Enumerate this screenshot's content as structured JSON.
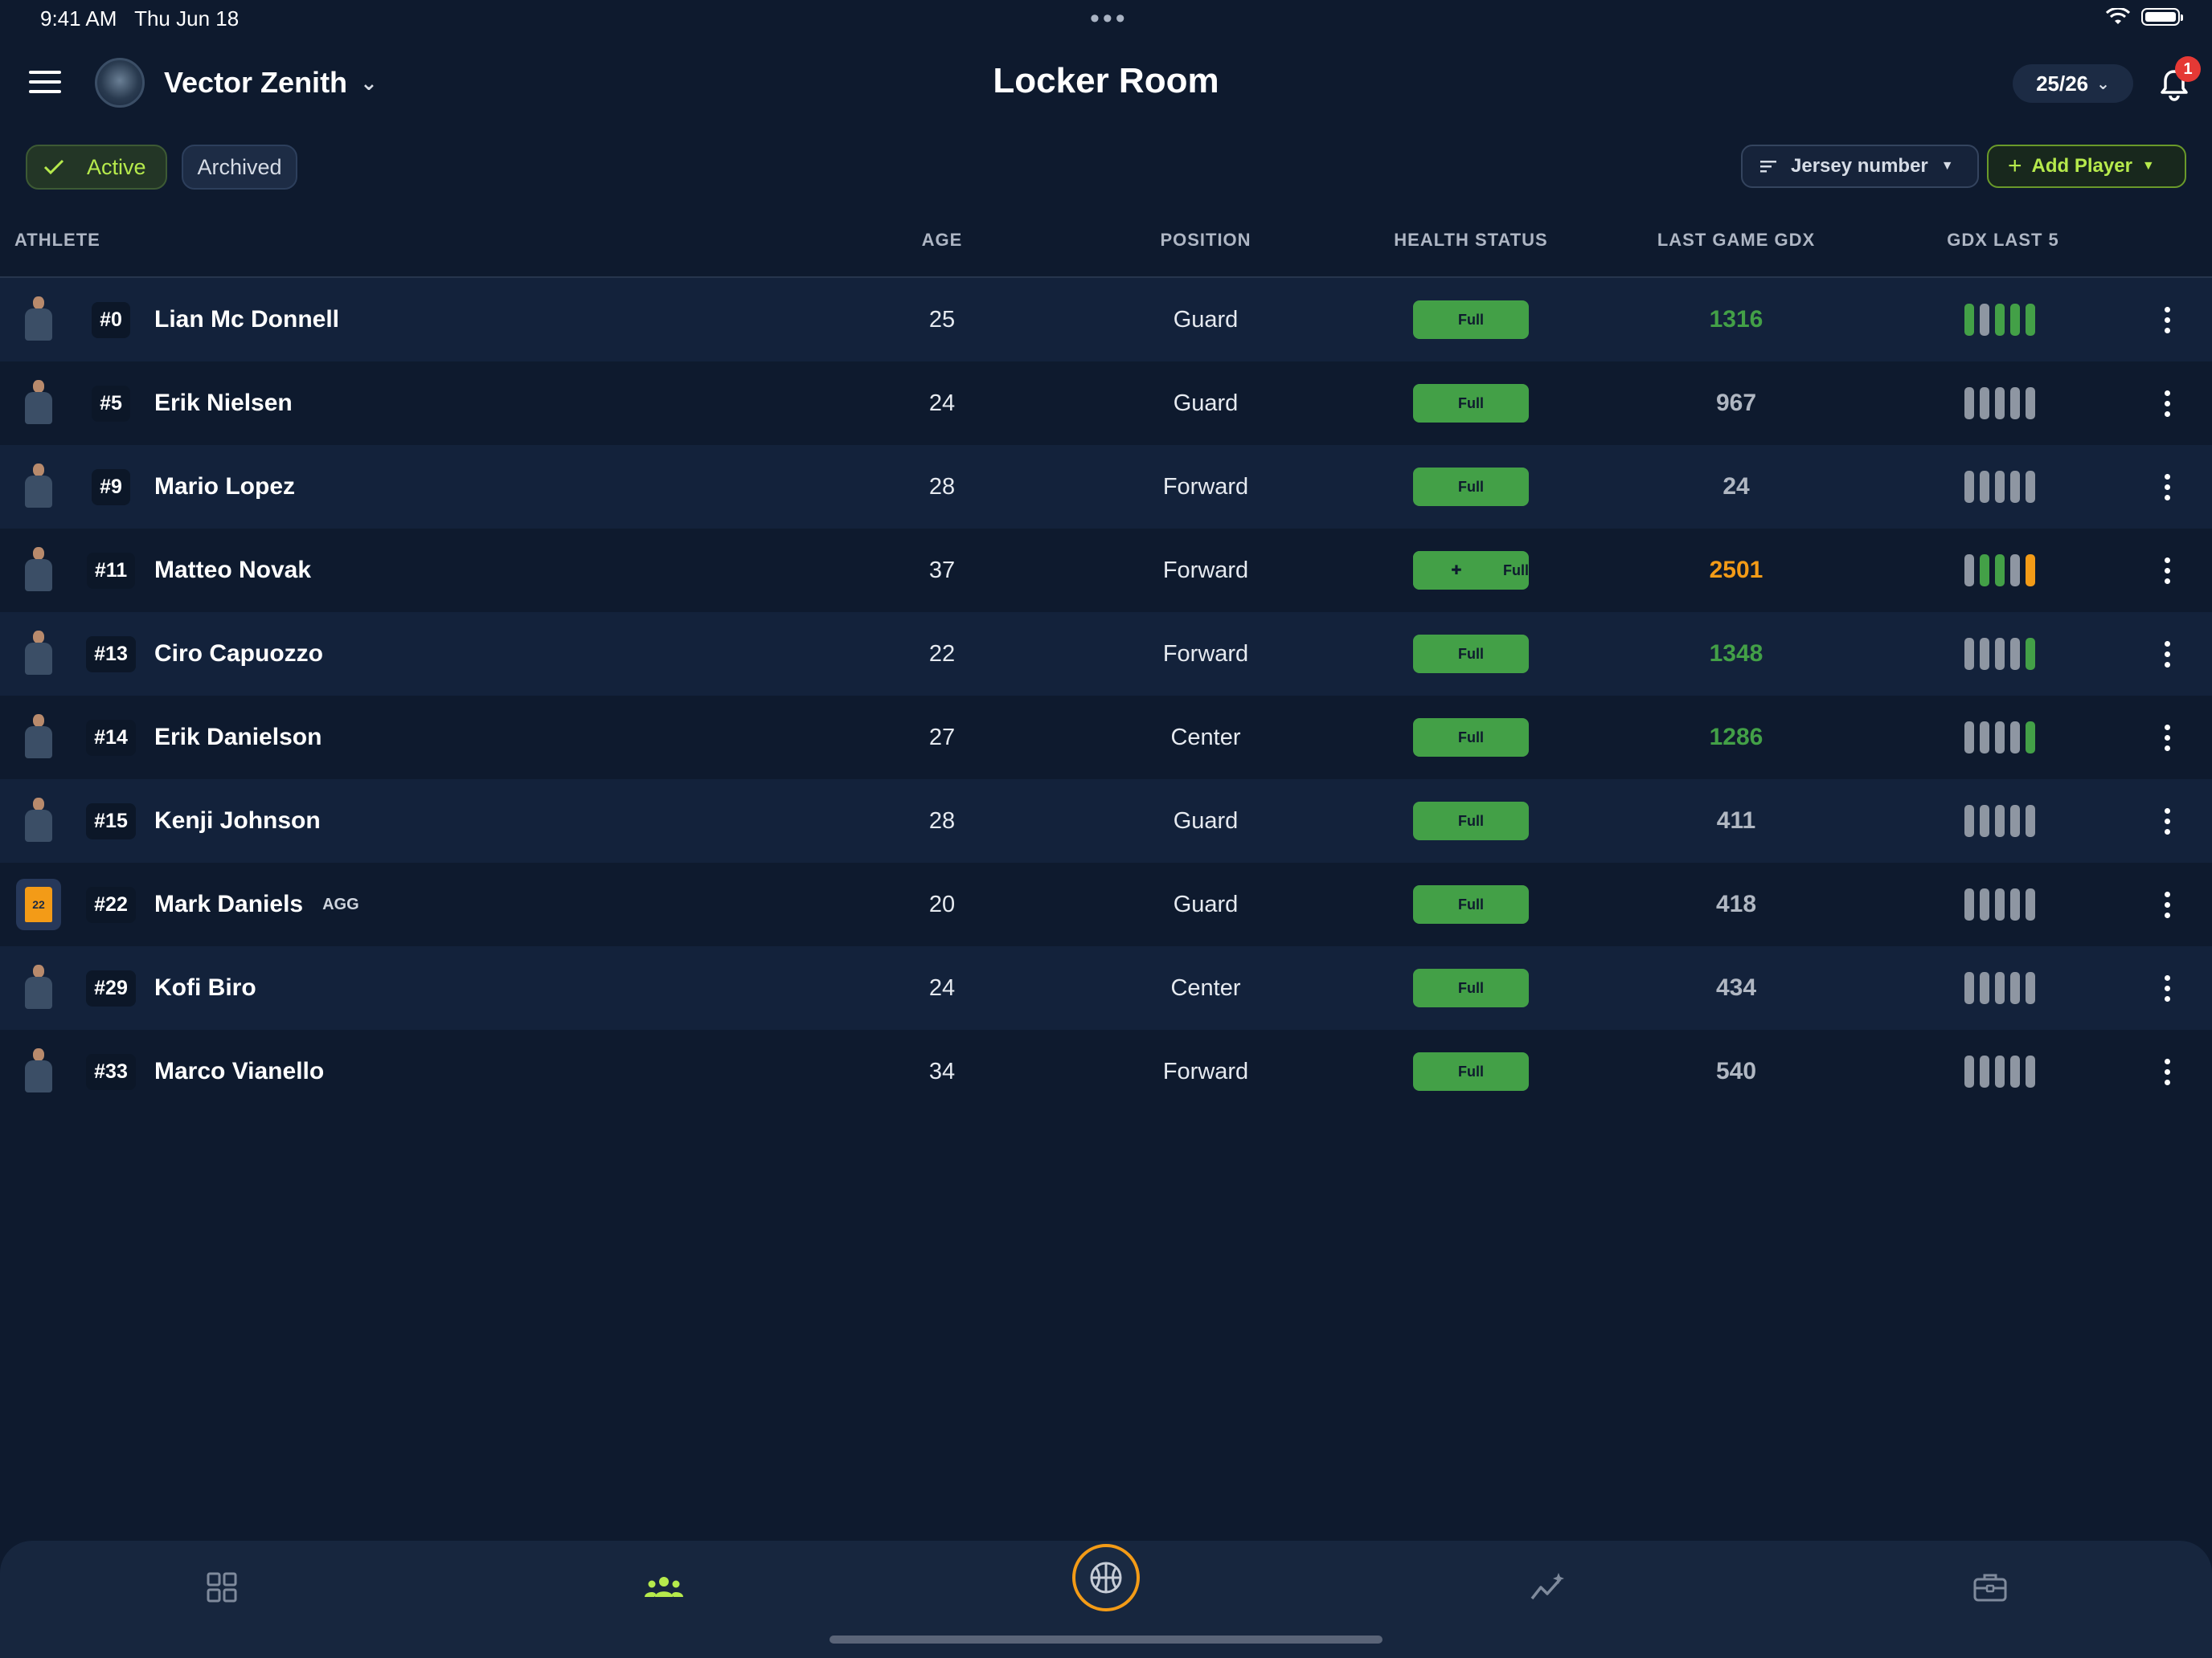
{
  "status_bar": {
    "time": "9:41 AM",
    "date": "Thu Jun 18",
    "dots": "•••"
  },
  "header": {
    "team_name": "Vector Zenith",
    "title": "Locker Room",
    "season": "25/26",
    "notification_count": "1"
  },
  "filters": {
    "active_label": "Active",
    "archived_label": "Archived",
    "selected": "Active"
  },
  "toolbar": {
    "sort_label": "Jersey number",
    "add_label": "Add Player"
  },
  "columns": [
    "ATHLETE",
    "AGE",
    "POSITION",
    "HEALTH STATUS",
    "LAST GAME GDX",
    "GDX LAST 5"
  ],
  "players": [
    {
      "number": "#0",
      "name": "Lian Mc Donnell",
      "tag": "",
      "age": "25",
      "position": "Guard",
      "health": "Full",
      "health_icon": false,
      "gdx": "1316",
      "gdx_color": "#43a047",
      "last5": [
        "#43a047",
        "#8e96a2",
        "#43a047",
        "#43a047",
        "#43a047"
      ]
    },
    {
      "number": "#5",
      "name": "Erik Nielsen",
      "tag": "",
      "age": "24",
      "position": "Guard",
      "health": "Full",
      "health_icon": false,
      "gdx": "967",
      "gdx_color": "#b0b7c2",
      "last5": [
        "#8e96a2",
        "#8e96a2",
        "#8e96a2",
        "#8e96a2",
        "#8e96a2"
      ]
    },
    {
      "number": "#9",
      "name": "Mario Lopez",
      "tag": "",
      "age": "28",
      "position": "Forward",
      "health": "Full",
      "health_icon": false,
      "gdx": "24",
      "gdx_color": "#b0b7c2",
      "last5": [
        "#8e96a2",
        "#8e96a2",
        "#8e96a2",
        "#8e96a2",
        "#8e96a2"
      ]
    },
    {
      "number": "#11",
      "name": "Matteo Novak",
      "tag": "",
      "age": "37",
      "position": "Forward",
      "health": "Full",
      "health_icon": true,
      "gdx": "2501",
      "gdx_color": "#f39b17",
      "last5": [
        "#8e96a2",
        "#43a047",
        "#43a047",
        "#8e96a2",
        "#f39b17"
      ]
    },
    {
      "number": "#13",
      "name": "Ciro Capuozzo",
      "tag": "",
      "age": "22",
      "position": "Forward",
      "health": "Full",
      "health_icon": false,
      "gdx": "1348",
      "gdx_color": "#43a047",
      "last5": [
        "#8e96a2",
        "#8e96a2",
        "#8e96a2",
        "#8e96a2",
        "#43a047"
      ]
    },
    {
      "number": "#14",
      "name": "Erik Danielson",
      "tag": "",
      "age": "27",
      "position": "Center",
      "health": "Full",
      "health_icon": false,
      "gdx": "1286",
      "gdx_color": "#43a047",
      "last5": [
        "#8e96a2",
        "#8e96a2",
        "#8e96a2",
        "#8e96a2",
        "#43a047"
      ]
    },
    {
      "number": "#15",
      "name": "Kenji Johnson",
      "tag": "",
      "age": "28",
      "position": "Guard",
      "health": "Full",
      "health_icon": false,
      "gdx": "411",
      "gdx_color": "#b0b7c2",
      "last5": [
        "#8e96a2",
        "#8e96a2",
        "#8e96a2",
        "#8e96a2",
        "#8e96a2"
      ]
    },
    {
      "number": "#22",
      "name": "Mark Daniels",
      "tag": "AGG",
      "age": "20",
      "position": "Guard",
      "health": "Full",
      "health_icon": false,
      "gdx": "418",
      "gdx_color": "#b0b7c2",
      "last5": [
        "#8e96a2",
        "#8e96a2",
        "#8e96a2",
        "#8e96a2",
        "#8e96a2"
      ],
      "avatar": "jersey",
      "jersey_number": "22"
    },
    {
      "number": "#29",
      "name": "Kofi Biro",
      "tag": "",
      "age": "24",
      "position": "Center",
      "health": "Full",
      "health_icon": false,
      "gdx": "434",
      "gdx_color": "#b0b7c2",
      "last5": [
        "#8e96a2",
        "#8e96a2",
        "#8e96a2",
        "#8e96a2",
        "#8e96a2"
      ]
    },
    {
      "number": "#33",
      "name": "Marco Vianello",
      "tag": "",
      "age": "34",
      "position": "Forward",
      "health": "Full",
      "health_icon": false,
      "gdx": "540",
      "gdx_color": "#b0b7c2",
      "last5": [
        "#8e96a2",
        "#8e96a2",
        "#8e96a2",
        "#8e96a2",
        "#8e96a2"
      ]
    }
  ],
  "bottom_nav": [
    {
      "icon": "grid-icon",
      "active": false
    },
    {
      "icon": "team-icon",
      "active": true
    },
    {
      "icon": "basketball-icon",
      "active": false
    },
    {
      "icon": "stats-icon",
      "active": false
    },
    {
      "icon": "briefcase-icon",
      "active": false
    }
  ],
  "colors": {
    "background": "#0e1a2e",
    "accent": "#b6ea4c",
    "health_full": "#43a047",
    "orange": "#f39b17",
    "badge_red": "#e53935"
  }
}
